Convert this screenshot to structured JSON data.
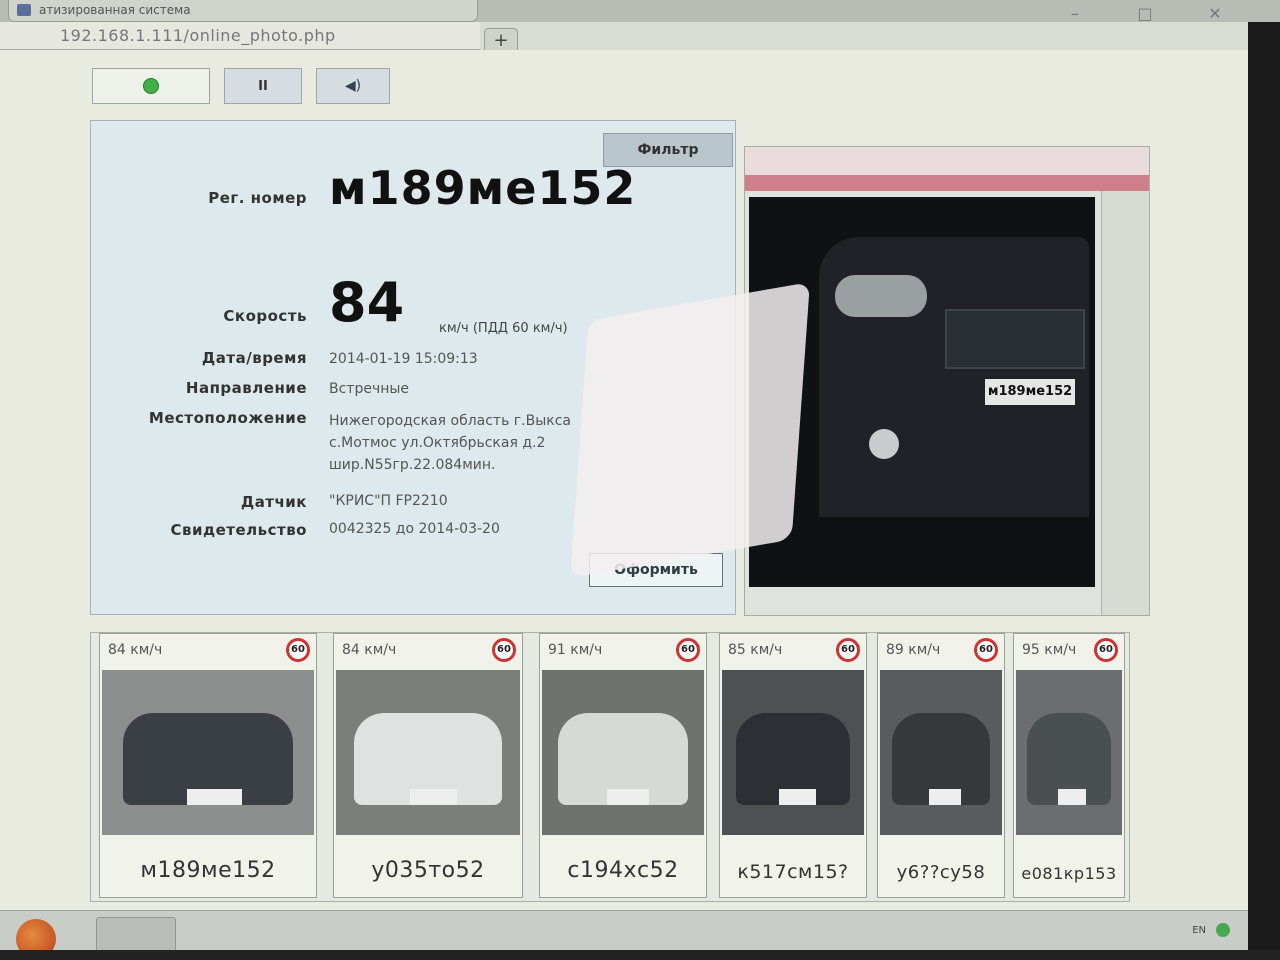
{
  "browser": {
    "tab_title": "атизированная система",
    "url": "192.168.1.111/online_photo.php",
    "new_tab_label": "+"
  },
  "controls": {
    "pause_symbol": "II",
    "sound_symbol": "◀)"
  },
  "info": {
    "filter_label": "Фильтр",
    "reg_label": "Рег. номер",
    "reg_value": "м189ме152",
    "speed_label": "Скорость",
    "speed_value": "84",
    "speed_unit": "км/ч (ПДД 60 км/ч)",
    "datetime_label": "Дата/время",
    "datetime_value": "2014-01-19 15:09:13",
    "direction_label": "Направление",
    "direction_value": "Встречные",
    "location_label": "Местоположение",
    "location_lines": [
      "Нижегородская область г.Выкса",
      "с.Мотмос ул.Октябрьская д.2",
      "шир.N55гр.22.084мин."
    ],
    "sensor_label": "Датчик",
    "sensor_value": "\"КРИС\"П FP2210",
    "certificate_label": "Свидетельство",
    "certificate_value": "0042325 до 2014-03-20",
    "submit_label": "Оформить"
  },
  "photo": {
    "plate": "м189ме152"
  },
  "thumbnails": [
    {
      "speed": "84 км/ч",
      "limit": "60",
      "plate": "м189ме152",
      "car_color": "#3a3f45"
    },
    {
      "speed": "84 км/ч",
      "limit": "60",
      "plate": "у035то52",
      "car_color": "#dfe2e0"
    },
    {
      "speed": "91 км/ч",
      "limit": "60",
      "plate": "с194хс52",
      "car_color": "#d7d9d4"
    },
    {
      "speed": "85 км/ч",
      "limit": "60",
      "plate": "к517см15?",
      "car_color": "#2c3034"
    },
    {
      "speed": "89 км/ч",
      "limit": "60",
      "plate": "у6??су58",
      "car_color": "#35393c"
    },
    {
      "speed": "95 км/ч",
      "limit": "60",
      "plate": "е081кр153",
      "car_color": "#4a4f52"
    }
  ],
  "taskbar": {
    "lang": "EN"
  }
}
